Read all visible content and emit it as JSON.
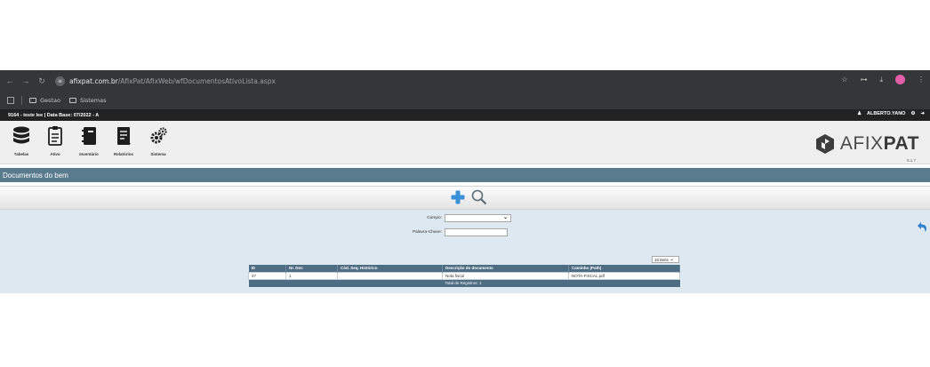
{
  "browser": {
    "url_host": "afixpat.com.br",
    "url_path": "/AfixPat/AfixWeb/wfDocumentosAtivoLista.aspx",
    "bookmarks": [
      {
        "label": "Gestao"
      },
      {
        "label": "Sistemas"
      }
    ]
  },
  "topbar": {
    "info": "9164 - teste lee | Data Base: 07/2022 - A",
    "user": "ALBERTO.YANO"
  },
  "menu": {
    "items": [
      {
        "label": "Tabelas",
        "icon": "database-icon"
      },
      {
        "label": "Ativo",
        "icon": "clipboard-icon"
      },
      {
        "label": "Inventário",
        "icon": "notebook-icon"
      },
      {
        "label": "Relatórios",
        "icon": "report-icon"
      },
      {
        "label": "Sistema",
        "icon": "gears-icon"
      }
    ],
    "logo_light": "AFIX",
    "logo_bold": "PAT",
    "version": "5.1.7"
  },
  "page": {
    "title": "Documentos do bem"
  },
  "form": {
    "campo_label": "Campo:",
    "campo_value": "",
    "palavra_label": "Palavra-Chave:",
    "palavra_value": ""
  },
  "grid": {
    "page_size": "10 itens",
    "headers": [
      "ID",
      "Nr. Doc",
      "Cód. Seq. Histórico",
      "Descrição do documento",
      "Caminho (Path)"
    ],
    "rows": [
      [
        "47",
        "1",
        "",
        "Nota fiscal",
        "NOTA-FISCAL.pdf"
      ]
    ],
    "total": "Total de Registros: 1"
  },
  "colors": {
    "section_bg": "#5a7a8e",
    "grid_header": "#4f6d82",
    "content_bg": "#dde8f1",
    "accent_blue": "#3a8fd9"
  }
}
